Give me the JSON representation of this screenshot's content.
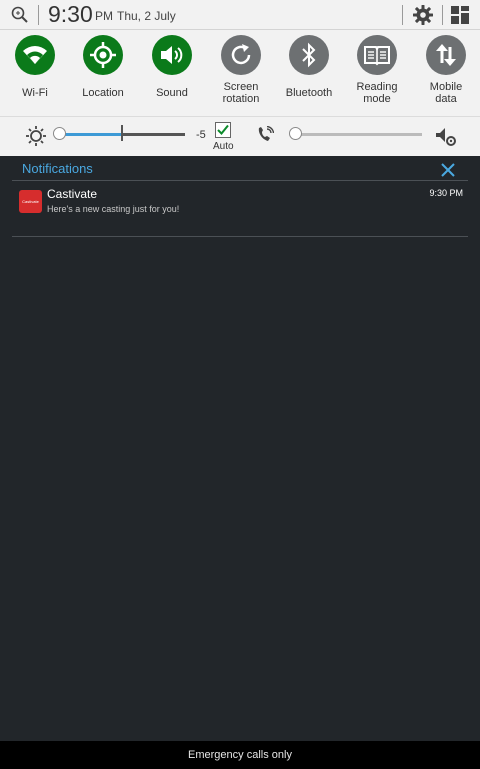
{
  "statusbar": {
    "time": "9:30",
    "ampm": "PM",
    "date": "Thu, 2 July"
  },
  "toggles": [
    {
      "label": "Wi-Fi",
      "icon": "wifi-icon",
      "on": true
    },
    {
      "label": "Location",
      "icon": "location-icon",
      "on": true
    },
    {
      "label": "Sound",
      "icon": "sound-icon",
      "on": true
    },
    {
      "label": "Screen\nrotation",
      "icon": "rotation-icon",
      "on": false
    },
    {
      "label": "Bluetooth",
      "icon": "bluetooth-icon",
      "on": false
    },
    {
      "label": "Reading\nmode",
      "icon": "book-icon",
      "on": false
    },
    {
      "label": "Mobile\ndata",
      "icon": "data-arrows-icon",
      "on": false
    }
  ],
  "brightness": {
    "value": "-5",
    "auto_label": "Auto",
    "auto_checked": true
  },
  "notifications": {
    "header": "Notifications",
    "items": [
      {
        "app_icon_text": "Castivate",
        "app": "Castivate",
        "message": "Here's a new casting just for you!",
        "time": "9:30 PM"
      }
    ]
  },
  "bottom": {
    "text": "Emergency calls only"
  },
  "colors": {
    "toggle_on": "#0b7a1a",
    "toggle_off": "#6d7072",
    "accent": "#4aa8e0",
    "panel_bg": "#22262a"
  }
}
